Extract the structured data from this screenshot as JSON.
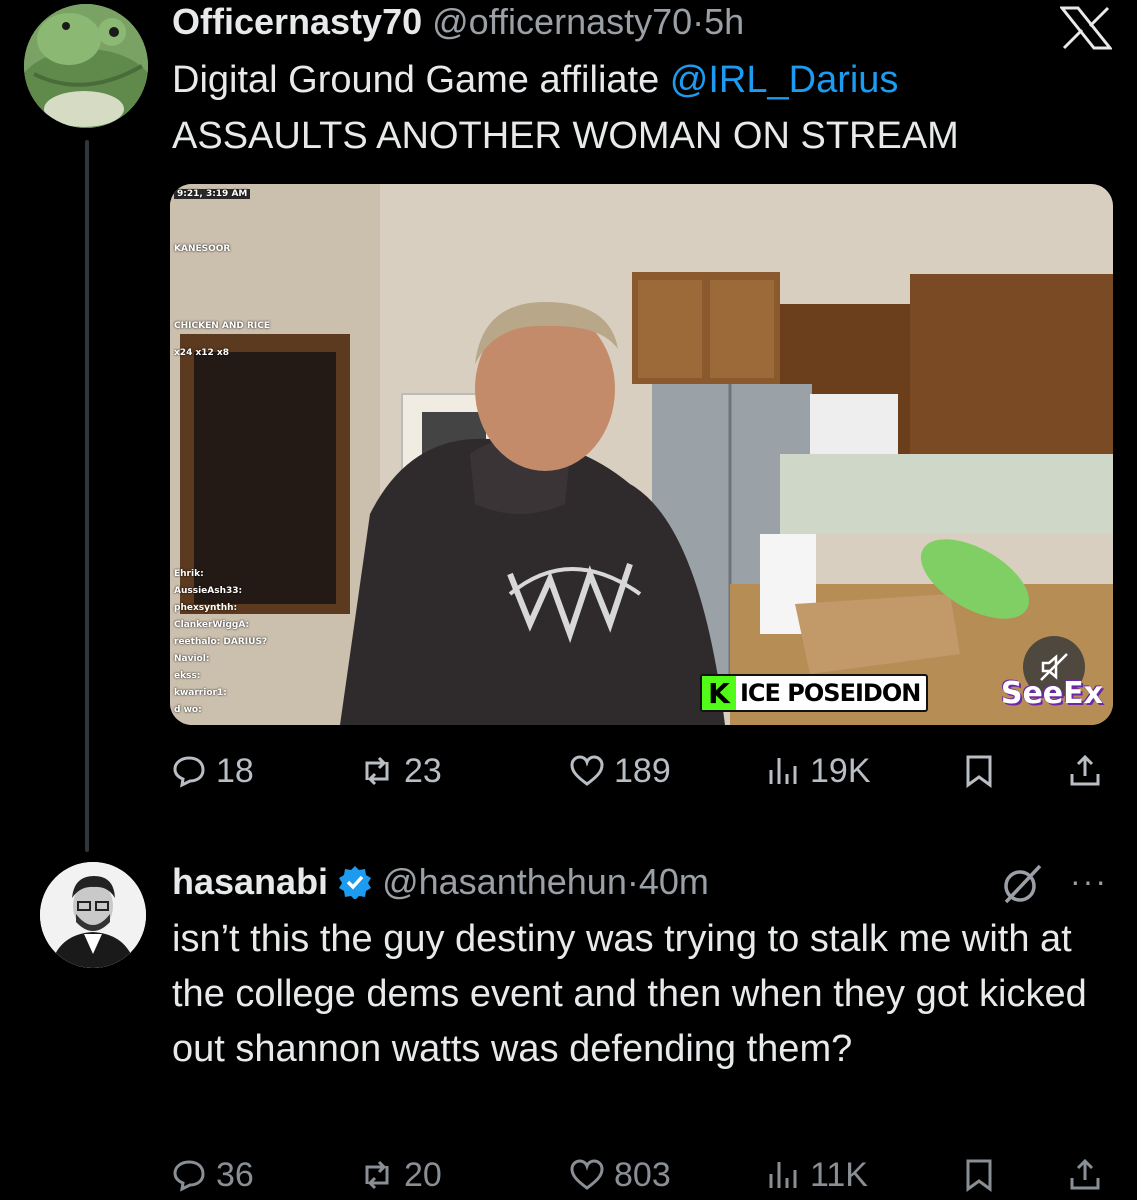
{
  "tweet1": {
    "display_name": "Officernasty70",
    "handle": "@officernasty70",
    "dot": "·",
    "time": "5h",
    "text_part1": "Digital Ground Game affiliate ",
    "mention": "@IRL_Darius",
    "text_part2": "ASSAULTS ANOTHER WOMAN ON STREAM",
    "media": {
      "chat_timestamp": "9:21, 3:19 AM",
      "chat_lines": [
        "Ehrik:",
        "AussieAsh33:",
        "phexsynthh:",
        "ClankerWiggA:",
        "reethalo: DARIUS?",
        "Naviol:",
        "ekss:",
        "kwarrior1:",
        "d wo:"
      ],
      "chat_top": [
        "KANESOOR",
        "CHICKEN AND RICE",
        "x24   x12   x8"
      ],
      "channel": "ICE POSEIDON",
      "channel_logo": "K",
      "watermark": "SeeEx"
    },
    "actions": {
      "replies": "18",
      "reposts": "23",
      "likes": "189",
      "views": "19K"
    }
  },
  "tweet2": {
    "display_name": "hasanabi",
    "handle": "@hasanthehun",
    "dot": "·",
    "time": "40m",
    "text": "isn’t this the guy destiny was trying to stalk me with at the college dems event and then when they got kicked out shannon watts was defending them?",
    "actions": {
      "replies": "36",
      "reposts": "20",
      "likes": "803",
      "views": "11K"
    }
  },
  "icons": {
    "more": "···"
  },
  "colors": {
    "background": "#000000",
    "text": "#e7e9ea",
    "muted": "#9aa0a6",
    "link": "#1d9bf0",
    "verified": "#1d9bf0",
    "kick_green": "#53fc18"
  }
}
